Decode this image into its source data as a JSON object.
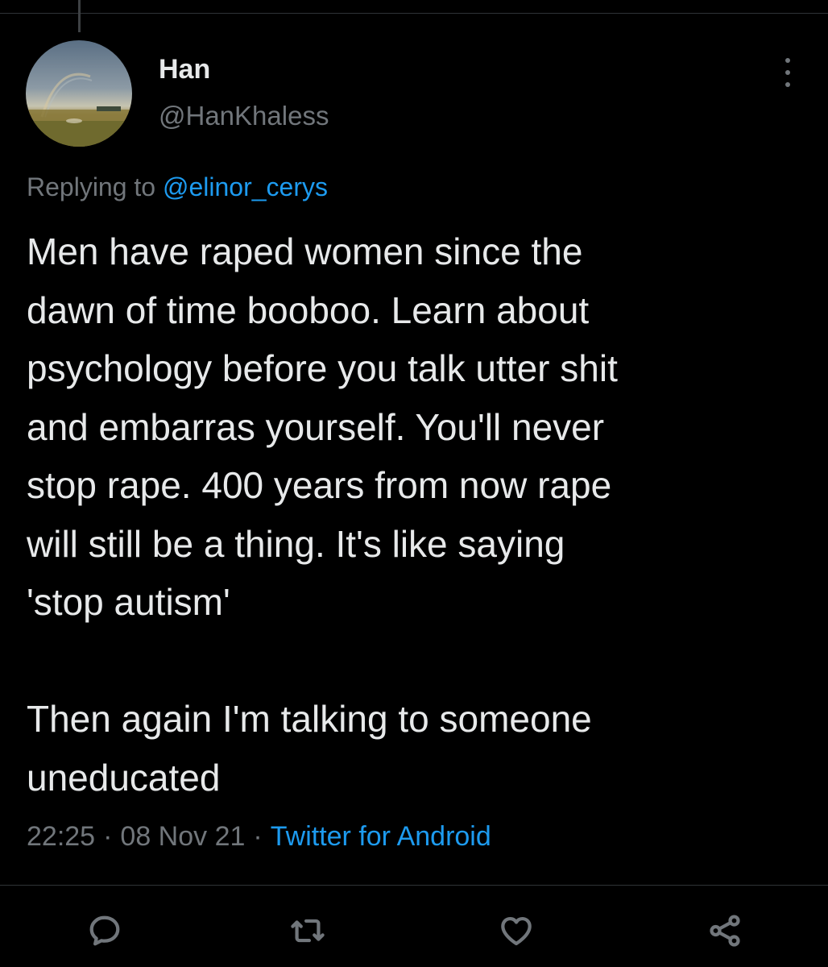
{
  "author": {
    "display_name": "Han",
    "handle": "@HanKhaless",
    "avatar": "landscape-rainbow-avatar"
  },
  "reply": {
    "prefix": "Replying to",
    "mention": "@elinor_cerys"
  },
  "tweet": {
    "text": "Men have raped women since the\ndawn of time booboo. Learn about\npsychology before you talk utter shit\nand embarras yourself. You'll never\nstop rape. 400 years from now rape\nwill still be a thing. It's like saying\n'stop autism'\n\nThen again I'm talking to someone\nuneducated"
  },
  "meta": {
    "time": "22:25",
    "separator": "·",
    "date": "08 Nov 21",
    "source": "Twitter for Android"
  },
  "actions": {
    "reply_icon": "speech-bubble-icon",
    "retweet_icon": "retweet-arrows-icon",
    "like_icon": "heart-icon",
    "share_icon": "share-nodes-icon",
    "more_icon": "vertical-ellipsis-icon"
  },
  "colors": {
    "background": "#000000",
    "text": "#e7e9ea",
    "muted": "#71767b",
    "accent": "#1d9bf0",
    "divider": "#2f3336"
  }
}
